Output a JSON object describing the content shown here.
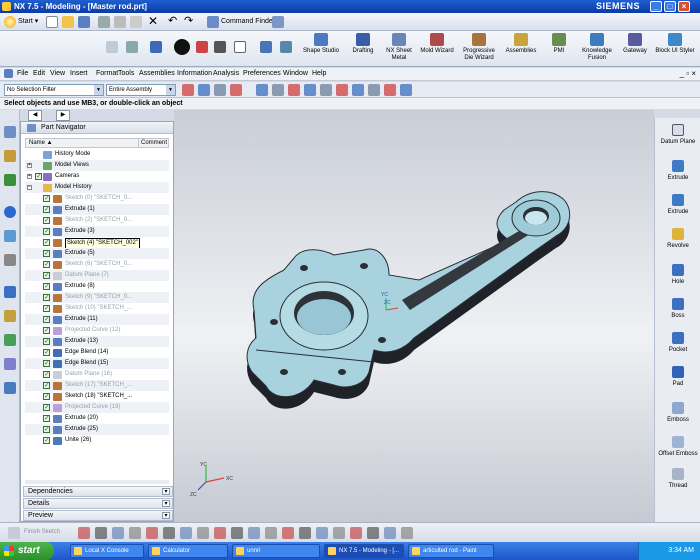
{
  "window": {
    "title": "NX 7.5 - Modeling - [Master rod.prt]",
    "brand": "SIEMENS"
  },
  "stdbar": {
    "start": "Start",
    "command_finder": "Command Finder"
  },
  "ribbon": {
    "items": [
      {
        "label": "Shape Studio",
        "icon": "shape-studio-icon"
      },
      {
        "label": "Drafting",
        "icon": "drafting-icon"
      },
      {
        "label": "NX Sheet Metal",
        "icon": "sheet-metal-icon"
      },
      {
        "label": "Mold Wizard",
        "icon": "mold-wizard-icon"
      },
      {
        "label": "Progressive Die Wizard",
        "icon": "progressive-die-icon"
      },
      {
        "label": "Assemblies",
        "icon": "assemblies-icon"
      },
      {
        "label": "PMI",
        "icon": "pmi-icon"
      },
      {
        "label": "Knowledge Fusion",
        "icon": "knowledge-fusion-icon"
      },
      {
        "label": "Gateway",
        "icon": "gateway-icon"
      },
      {
        "label": "Block UI Styler",
        "icon": "block-ui-styler-icon"
      }
    ]
  },
  "menu": [
    "File",
    "Edit",
    "View",
    "Insert",
    "Format",
    "Tools",
    "Assemblies",
    "Information",
    "Analysis",
    "Preferences",
    "Window",
    "Help"
  ],
  "selection": {
    "filter": "No Selection Filter",
    "scope": "Entire Assembly"
  },
  "status": "Select objects and use MB3, or double-click an object",
  "navigator": {
    "title": "Part Navigator",
    "columns": {
      "name": "Name",
      "comment": "Comment"
    },
    "rows": [
      {
        "label": "History Mode",
        "level": 0,
        "icon": "clock",
        "exp": "",
        "chk": false,
        "grey": false
      },
      {
        "label": "Model Views",
        "level": 0,
        "icon": "views",
        "exp": "+",
        "chk": false,
        "grey": false
      },
      {
        "label": "Cameras",
        "level": 0,
        "icon": "camera",
        "exp": "+",
        "chk": true,
        "grey": false
      },
      {
        "label": "Model History",
        "level": 0,
        "icon": "folder",
        "exp": "−",
        "chk": false,
        "grey": false
      },
      {
        "label": "Sketch (0) \"SKETCH_0...",
        "level": 1,
        "icon": "sketch",
        "chk": true,
        "grey": true
      },
      {
        "label": "Extrude (1)",
        "level": 1,
        "icon": "extrude",
        "chk": true,
        "grey": false
      },
      {
        "label": "Sketch (2) \"SKETCH_0...",
        "level": 1,
        "icon": "sketch",
        "chk": true,
        "grey": true
      },
      {
        "label": "Extrude (3)",
        "level": 1,
        "icon": "extrude",
        "chk": true,
        "grey": false
      },
      {
        "label": "Sketch (4) \"SKETCH_002\"",
        "level": 1,
        "icon": "sketch",
        "chk": true,
        "grey": false,
        "sel": true
      },
      {
        "label": "Extrude (5)",
        "level": 1,
        "icon": "extrude",
        "chk": true,
        "grey": false
      },
      {
        "label": "Sketch (6) \"SKETCH_0...",
        "level": 1,
        "icon": "sketch",
        "chk": true,
        "grey": true
      },
      {
        "label": "Datum Plane (7)",
        "level": 1,
        "icon": "datum",
        "chk": true,
        "grey": true
      },
      {
        "label": "Extrude (8)",
        "level": 1,
        "icon": "extrude",
        "chk": true,
        "grey": false
      },
      {
        "label": "Sketch (9) \"SKETCH_0...",
        "level": 1,
        "icon": "sketch",
        "chk": true,
        "grey": true
      },
      {
        "label": "Sketch (10) \"SKETCH_...",
        "level": 1,
        "icon": "sketch",
        "chk": true,
        "grey": true
      },
      {
        "label": "Extrude (11)",
        "level": 1,
        "icon": "extrude",
        "chk": true,
        "grey": false
      },
      {
        "label": "Projected Curve (12)",
        "level": 1,
        "icon": "curve",
        "chk": true,
        "grey": true
      },
      {
        "label": "Extrude (13)",
        "level": 1,
        "icon": "extrude",
        "chk": true,
        "grey": false
      },
      {
        "label": "Edge Blend (14)",
        "level": 1,
        "icon": "blend",
        "chk": true,
        "grey": false
      },
      {
        "label": "Edge Blend (15)",
        "level": 1,
        "icon": "blend",
        "chk": true,
        "grey": false
      },
      {
        "label": "Datum Plane (16)",
        "level": 1,
        "icon": "datum",
        "chk": true,
        "grey": true
      },
      {
        "label": "Sketch (17) \"SKETCH_...",
        "level": 1,
        "icon": "sketch",
        "chk": true,
        "grey": true
      },
      {
        "label": "Sketch (18) \"SKETCH_...",
        "level": 1,
        "icon": "sketch",
        "chk": true,
        "grey": false
      },
      {
        "label": "Projected Curve (19)",
        "level": 1,
        "icon": "curve",
        "chk": true,
        "grey": true
      },
      {
        "label": "Extrude (20)",
        "level": 1,
        "icon": "extrude",
        "chk": true,
        "grey": false
      },
      {
        "label": "Extrude (25)",
        "level": 1,
        "icon": "extrude",
        "chk": true,
        "grey": false
      },
      {
        "label": "Unite (26)",
        "level": 1,
        "icon": "unite",
        "chk": true,
        "grey": false
      }
    ],
    "panels": [
      "Dependencies",
      "Details",
      "Preview"
    ]
  },
  "right_features": [
    {
      "label": "Datum Plane",
      "icon": "datum-plane-icon"
    },
    {
      "label": "Extrude",
      "icon": "extrude-icon"
    },
    {
      "label": "Extrude",
      "icon": "extrude-icon"
    },
    {
      "label": "Revolve",
      "icon": "revolve-icon"
    },
    {
      "label": "Hole",
      "icon": "hole-icon"
    },
    {
      "label": "Boss",
      "icon": "boss-icon"
    },
    {
      "label": "Pocket",
      "icon": "pocket-icon"
    },
    {
      "label": "Pad",
      "icon": "pad-icon"
    },
    {
      "label": "Emboss",
      "icon": "emboss-icon"
    },
    {
      "label": "Offset Emboss",
      "icon": "offset-emboss-icon"
    },
    {
      "label": "Thread",
      "icon": "thread-icon"
    }
  ],
  "sketchbar": {
    "finish": "Finish Sketch"
  },
  "viewport": {
    "triad_x": "XC",
    "triad_y": "YC",
    "triad_z": "ZC"
  },
  "taskbar": {
    "start": "start",
    "tasks": [
      "Local X Console",
      "Calculator",
      "unnri",
      "NX 7.5 - Modeling - [...",
      "articulted rod - Paint"
    ],
    "clock": "3:34 AM"
  },
  "colors": {
    "accent": "#0b3aa8",
    "part": "#a9d3e0",
    "part_shadow": "#2a2f36"
  }
}
